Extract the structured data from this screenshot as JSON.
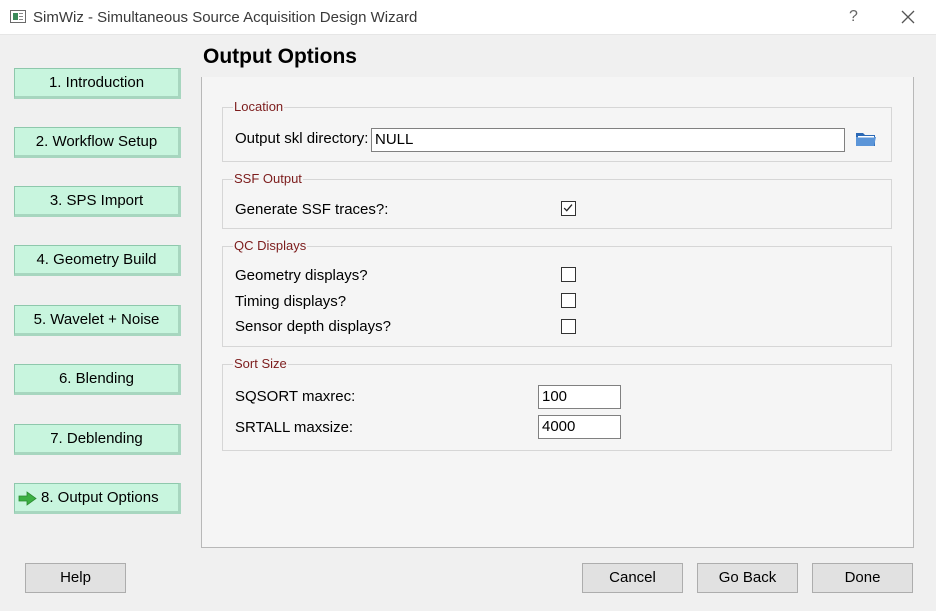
{
  "window": {
    "title": "SimWiz - Simultaneous Source Acquisition Design Wizard",
    "help_glyph": "?"
  },
  "nav": [
    {
      "label": "1. Introduction"
    },
    {
      "label": "2. Workflow Setup"
    },
    {
      "label": "3. SPS Import"
    },
    {
      "label": "4. Geometry Build"
    },
    {
      "label": "5. Wavelet + Noise"
    },
    {
      "label": "6. Blending"
    },
    {
      "label": "7. Deblending"
    },
    {
      "label": "8. Output Options",
      "active": true,
      "icon": "arrow-right-icon"
    }
  ],
  "page": {
    "title": "Output Options"
  },
  "location": {
    "title": "Location",
    "output_dir_label": "Output skl directory:",
    "output_dir_value": "NULL",
    "browse_icon": "folder-icon"
  },
  "ssf_output": {
    "title": "SSF Output",
    "generate_label": "Generate SSF traces?:",
    "generate_checked": true
  },
  "qc_displays": {
    "title": "QC Displays",
    "items": [
      {
        "label": "Geometry displays?",
        "checked": false
      },
      {
        "label": "Timing displays?",
        "checked": false
      },
      {
        "label": "Sensor depth displays?",
        "checked": false
      }
    ]
  },
  "sort_size": {
    "title": "Sort Size",
    "sqsort_label": "SQSORT maxrec:",
    "sqsort_value": "100",
    "srtall_label": "SRTALL maxsize:",
    "srtall_value": "4000"
  },
  "buttons": {
    "help": "Help",
    "cancel": "Cancel",
    "back": "Go Back",
    "done": "Done"
  },
  "colors": {
    "nav_bg": "#c8f5de",
    "group_title": "#7c1c1c",
    "arrow": "#3cb043",
    "folder": "#2a68b5"
  }
}
